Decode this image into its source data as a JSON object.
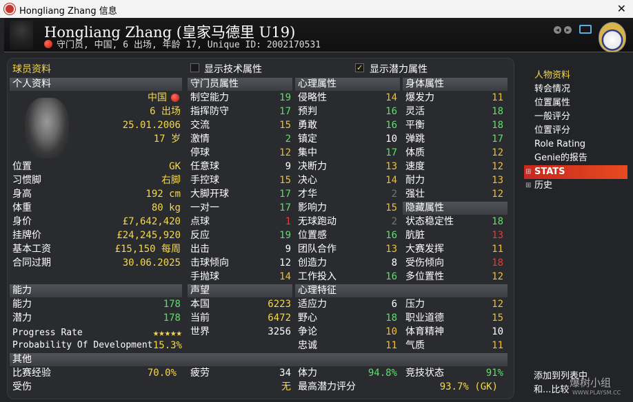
{
  "window": {
    "title": "Hongliang Zhang 信息",
    "close_label": "✕"
  },
  "header": {
    "name": "Hongliang Zhang (皇家马德里 U19)",
    "info": "守门员, 中国, 6 出场, 年龄 17, Unique ID: 2002170531"
  },
  "top": {
    "section_label": "球员资料",
    "show_tech": "显示技术属性",
    "show_potential": "显示潜力属性",
    "check_mark": "✓"
  },
  "personal": {
    "title": "个人资料",
    "nation": "中国",
    "apps": "6 出场",
    "dob": "25.01.2006",
    "age": "17 岁",
    "rows": [
      {
        "l": "位置",
        "v": "GK"
      },
      {
        "l": "习惯脚",
        "v": "右脚"
      },
      {
        "l": "身高",
        "v": "192 cm"
      },
      {
        "l": "体重",
        "v": "80 kg"
      },
      {
        "l": "身价",
        "v": "£7,642,420"
      },
      {
        "l": "挂牌价",
        "v": "£24,245,920"
      },
      {
        "l": "基本工资",
        "v": "£15,150 每周"
      },
      {
        "l": "合同过期",
        "v": "30.06.2025"
      }
    ]
  },
  "gk": {
    "title": "守门员属性",
    "rows": [
      {
        "l": "制空能力",
        "v": "19",
        "c": "green"
      },
      {
        "l": "指挥防守",
        "v": "17",
        "c": "green"
      },
      {
        "l": "交流",
        "v": "15",
        "c": "orange"
      },
      {
        "l": "激情",
        "v": "2",
        "c": "green"
      },
      {
        "l": "停球",
        "v": "12",
        "c": "orange"
      },
      {
        "l": "任意球",
        "v": "9",
        "c": "white"
      },
      {
        "l": "手控球",
        "v": "15",
        "c": "orange"
      },
      {
        "l": "大脚开球",
        "v": "17",
        "c": "green"
      },
      {
        "l": "一对一",
        "v": "17",
        "c": "green"
      },
      {
        "l": "点球",
        "v": "1",
        "c": "red"
      },
      {
        "l": "反应",
        "v": "19",
        "c": "green"
      },
      {
        "l": "出击",
        "v": "9",
        "c": "white"
      },
      {
        "l": "击球倾向",
        "v": "12",
        "c": "white"
      },
      {
        "l": "手抛球",
        "v": "14",
        "c": "orange"
      }
    ]
  },
  "mental": {
    "title": "心理属性",
    "rows": [
      {
        "l": "侵略性",
        "v": "14",
        "c": "orange"
      },
      {
        "l": "预判",
        "v": "16",
        "c": "green"
      },
      {
        "l": "勇敢",
        "v": "16",
        "c": "green"
      },
      {
        "l": "镇定",
        "v": "10",
        "c": "white"
      },
      {
        "l": "集中",
        "v": "17",
        "c": "green"
      },
      {
        "l": "决断力",
        "v": "13",
        "c": "orange"
      },
      {
        "l": "决心",
        "v": "14",
        "c": "orange"
      },
      {
        "l": "才华",
        "v": "2",
        "c": "grey"
      },
      {
        "l": "影响力",
        "v": "15",
        "c": "orange"
      },
      {
        "l": "无球跑动",
        "v": "2",
        "c": "grey"
      },
      {
        "l": "位置感",
        "v": "16",
        "c": "green"
      },
      {
        "l": "团队合作",
        "v": "13",
        "c": "orange"
      },
      {
        "l": "创造力",
        "v": "8",
        "c": "white"
      },
      {
        "l": "工作投入",
        "v": "16",
        "c": "green"
      }
    ]
  },
  "physical": {
    "title": "身体属性",
    "rows": [
      {
        "l": "爆发力",
        "v": "11",
        "c": "orange"
      },
      {
        "l": "灵活",
        "v": "18",
        "c": "green"
      },
      {
        "l": "平衡",
        "v": "18",
        "c": "green"
      },
      {
        "l": "弹跳",
        "v": "17",
        "c": "green"
      },
      {
        "l": "体质",
        "v": "12",
        "c": "orange"
      },
      {
        "l": "速度",
        "v": "12",
        "c": "orange"
      },
      {
        "l": "耐力",
        "v": "13",
        "c": "orange"
      },
      {
        "l": "强壮",
        "v": "12",
        "c": "orange"
      }
    ]
  },
  "hidden": {
    "title": "隐藏属性",
    "rows": [
      {
        "l": "状态稳定性",
        "v": "18",
        "c": "green"
      },
      {
        "l": "肮脏",
        "v": "13",
        "c": "red"
      },
      {
        "l": "大赛发挥",
        "v": "11",
        "c": "orange"
      },
      {
        "l": "受伤倾向",
        "v": "18",
        "c": "red"
      },
      {
        "l": "多位置性",
        "v": "12",
        "c": "orange"
      }
    ]
  },
  "ability": {
    "title": "能力",
    "rows": [
      {
        "l": "能力",
        "v": "178",
        "c": "green"
      },
      {
        "l": "潜力",
        "v": "178",
        "c": "green"
      }
    ],
    "progress_label": "Progress Rate",
    "stars": "★★★★★",
    "prob_label": "Probability Of Development",
    "prob_value": "15.3%"
  },
  "reputation": {
    "title": "声望",
    "rows": [
      {
        "l": "本国",
        "v": "6223",
        "c": "yellow"
      },
      {
        "l": "当前",
        "v": "6472",
        "c": "yellow"
      },
      {
        "l": "世界",
        "v": "3256",
        "c": "white"
      }
    ]
  },
  "traits": {
    "title": "心理特征",
    "rows": [
      {
        "l": "适应力",
        "v": "6",
        "c": "white",
        "l2": "压力",
        "v2": "12",
        "c2": "orange"
      },
      {
        "l": "野心",
        "v": "18",
        "c": "green",
        "l2": "职业道德",
        "v2": "15",
        "c2": "orange"
      },
      {
        "l": "争论",
        "v": "10",
        "c": "orange",
        "l2": "体育精神",
        "v2": "10",
        "c2": "white"
      },
      {
        "l": "忠诚",
        "v": "11",
        "c": "orange",
        "l2": "气质",
        "v2": "11",
        "c2": "orange"
      }
    ]
  },
  "other": {
    "title": "其他",
    "exp_label": "比赛经验",
    "exp_value": "70.0%",
    "injury_label": "受伤",
    "fatigue_label": "疲劳",
    "fatigue_value": "34",
    "injury_value": "无",
    "stamina_label": "体力",
    "stamina_value": "94.8%",
    "form_label": "竞技状态",
    "form_value": "91%",
    "best_pot_label": "最高潜力评分",
    "best_pot_value": "93.7% (GK)"
  },
  "sidebar": {
    "items": [
      "人物资料",
      "转会情况",
      "位置属性",
      "一般评分",
      "位置评分",
      "Role Rating",
      "Genie的报告"
    ],
    "stats": "STATS",
    "history": "历史",
    "add_list": "添加到列表中",
    "compare": "和...比较"
  },
  "watermark": {
    "text": "爆树小组",
    "sub": "WWW.PLAYSM.CC"
  }
}
